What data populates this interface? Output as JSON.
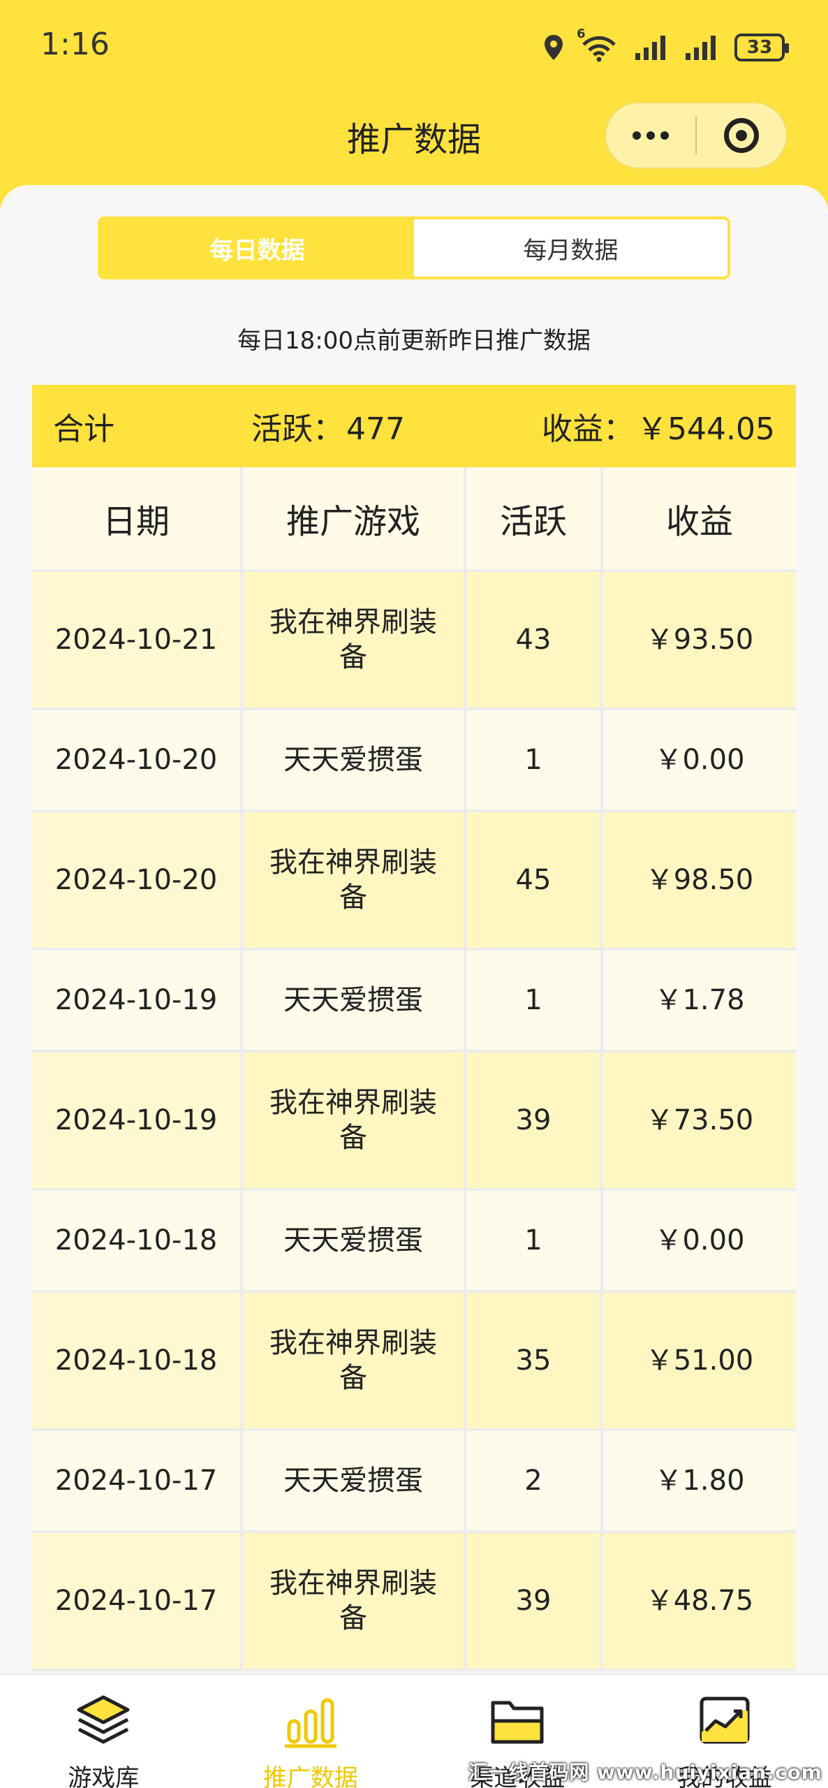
{
  "status_bar": {
    "time": "1:16",
    "network_badge": "6",
    "battery": "33"
  },
  "nav": {
    "title": "推广数据"
  },
  "tabs": [
    {
      "label": "每日数据",
      "active": true
    },
    {
      "label": "每月数据",
      "active": false
    }
  ],
  "notice": "每日18:00点前更新昨日推广数据",
  "summary": {
    "label": "合计",
    "active_label": "活跃：",
    "active_value": "477",
    "income_label": "收益：",
    "income_value": "￥544.05"
  },
  "table": {
    "headers": [
      "日期",
      "推广游戏",
      "活跃",
      "收益"
    ],
    "rows": [
      {
        "date": "2024-10-21",
        "game": "我在神界刷装备",
        "active": "43",
        "income": "￥93.50"
      },
      {
        "date": "2024-10-20",
        "game": "天天爱掼蛋",
        "active": "1",
        "income": "￥0.00"
      },
      {
        "date": "2024-10-20",
        "game": "我在神界刷装备",
        "active": "45",
        "income": "￥98.50"
      },
      {
        "date": "2024-10-19",
        "game": "天天爱掼蛋",
        "active": "1",
        "income": "￥1.78"
      },
      {
        "date": "2024-10-19",
        "game": "我在神界刷装备",
        "active": "39",
        "income": "￥73.50"
      },
      {
        "date": "2024-10-18",
        "game": "天天爱掼蛋",
        "active": "1",
        "income": "￥0.00"
      },
      {
        "date": "2024-10-18",
        "game": "我在神界刷装备",
        "active": "35",
        "income": "￥51.00"
      },
      {
        "date": "2024-10-17",
        "game": "天天爱掼蛋",
        "active": "2",
        "income": "￥1.80"
      },
      {
        "date": "2024-10-17",
        "game": "我在神界刷装备",
        "active": "39",
        "income": "￥48.75"
      }
    ]
  },
  "bottom_nav": [
    {
      "label": "游戏库",
      "icon": "layers-icon"
    },
    {
      "label": "推广数据",
      "icon": "bar-chart-icon",
      "active": true
    },
    {
      "label": "渠道收益",
      "icon": "folder-icon"
    },
    {
      "label": "我的收益",
      "icon": "trend-chart-icon"
    }
  ],
  "watermark": "汇一线首码网 www.huiyixian.com",
  "colors": {
    "accent": "#ffe23d",
    "row_odd": "#fff6c2",
    "row_even": "#fffbea",
    "active_nav": "#f0c800"
  }
}
